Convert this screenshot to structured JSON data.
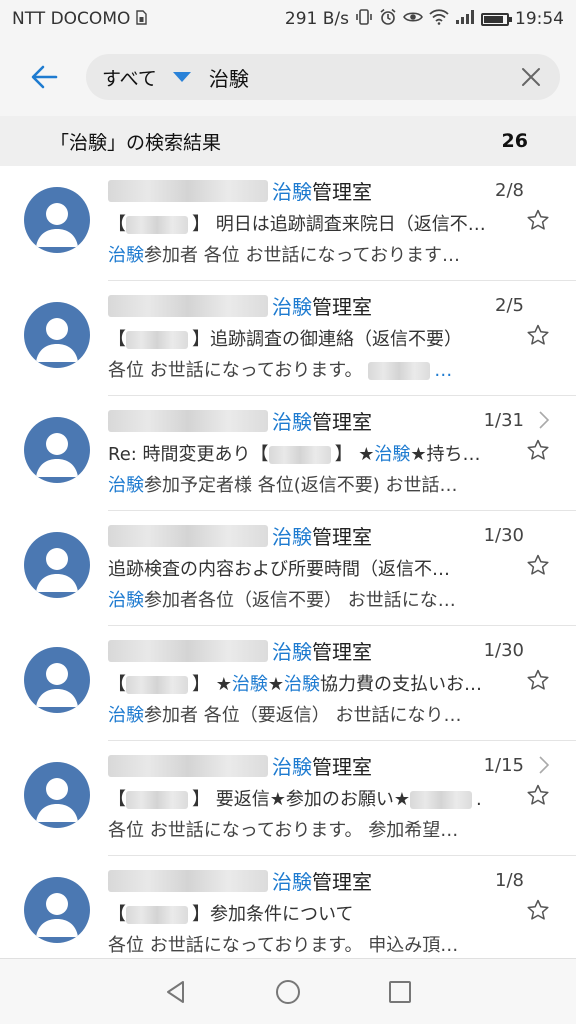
{
  "status_bar": {
    "carrier": "NTT DOCOMO",
    "speed": "291 B/s",
    "time": "19:54",
    "battery_level": 0.85,
    "icons": [
      "sim-icon",
      "vibrate-icon",
      "alarm-icon",
      "eye-icon",
      "wifi-icon",
      "signal-icon",
      "battery-icon"
    ]
  },
  "search": {
    "scope": "すべて",
    "query": "治験"
  },
  "results": {
    "label": "「治験」の検索結果",
    "count": "26"
  },
  "items": [
    {
      "sender": "管理室",
      "highlight": "治験",
      "date": "2/8",
      "line2": [
        {
          "t": "【",
          "c": ""
        },
        {
          "t": "",
          "c": "blur"
        },
        {
          "t": "】 明日は追跡調査来院日（返信不…",
          "c": ""
        }
      ],
      "line3": [
        {
          "t": "治験",
          "c": "blue"
        },
        {
          "t": "参加者 各位 お世話になっております…",
          "c": ""
        }
      ],
      "thread": false
    },
    {
      "sender": "管理室",
      "highlight": "治験",
      "date": "2/5",
      "line2": [
        {
          "t": "【",
          "c": ""
        },
        {
          "t": "",
          "c": "blur"
        },
        {
          "t": "】追跡調査の御連絡（返信不要）",
          "c": ""
        }
      ],
      "line3": [
        {
          "t": "各位 お世話になっております。 ",
          "c": ""
        },
        {
          "t": "",
          "c": "blur"
        },
        {
          "t": "…",
          "c": "blue"
        }
      ],
      "thread": false
    },
    {
      "sender": "管理室",
      "highlight": "治験",
      "date": "1/31",
      "line2": [
        {
          "t": "Re: 時間変更あり【",
          "c": ""
        },
        {
          "t": "",
          "c": "blur"
        },
        {
          "t": "】 ★",
          "c": ""
        },
        {
          "t": "治験",
          "c": "blue"
        },
        {
          "t": "★持ち…",
          "c": ""
        }
      ],
      "line3": [
        {
          "t": "治験",
          "c": "blue"
        },
        {
          "t": "参加予定者様 各位(返信不要) お世話…",
          "c": ""
        }
      ],
      "thread": true
    },
    {
      "sender": "管理室",
      "highlight": "治験",
      "date": "1/30",
      "line2": [
        {
          "t": "追跡検査の内容および所要時間（返信不…",
          "c": ""
        }
      ],
      "line3": [
        {
          "t": "治験",
          "c": "blue"
        },
        {
          "t": "参加者各位（返信不要） お世話にな…",
          "c": ""
        }
      ],
      "thread": false
    },
    {
      "sender": "管理室",
      "highlight": "治験",
      "date": "1/30",
      "line2": [
        {
          "t": "【",
          "c": ""
        },
        {
          "t": "",
          "c": "blur"
        },
        {
          "t": "】 ★",
          "c": ""
        },
        {
          "t": "治験",
          "c": "blue"
        },
        {
          "t": "★",
          "c": ""
        },
        {
          "t": "治験",
          "c": "blue"
        },
        {
          "t": "協力費の支払いお…",
          "c": ""
        }
      ],
      "line3": [
        {
          "t": "治験",
          "c": "blue"
        },
        {
          "t": "参加者 各位（要返信） お世話になり…",
          "c": ""
        }
      ],
      "thread": false
    },
    {
      "sender": "管理室",
      "highlight": "治験",
      "date": "1/15",
      "line2": [
        {
          "t": "【",
          "c": ""
        },
        {
          "t": "",
          "c": "blur"
        },
        {
          "t": "】 要返信★参加のお願い★",
          "c": ""
        },
        {
          "t": "",
          "c": "blur"
        },
        {
          "t": ".",
          "c": ""
        }
      ],
      "line3": [
        {
          "t": "各位 お世話になっております。 参加希望…",
          "c": ""
        }
      ],
      "thread": true
    },
    {
      "sender": "管理室",
      "highlight": "治験",
      "date": "1/8",
      "line2": [
        {
          "t": "【",
          "c": ""
        },
        {
          "t": "",
          "c": "blur"
        },
        {
          "t": "】参加条件について",
          "c": ""
        }
      ],
      "line3": [
        {
          "t": "各位 お世話になっております。 申込み頂…",
          "c": ""
        }
      ],
      "thread": false
    }
  ],
  "navbar": [
    "back-triangle-icon",
    "home-circle-icon",
    "recents-square-icon"
  ],
  "colors": {
    "accent": "#1e7bd0",
    "avatar": "#4b78b2"
  }
}
